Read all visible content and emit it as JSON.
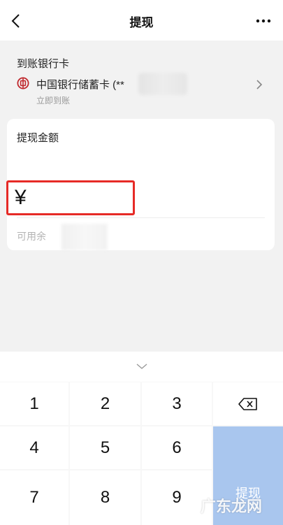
{
  "header": {
    "title": "提现",
    "back_icon": "chevron-left-icon",
    "more_icon": "more-dots-icon"
  },
  "bank": {
    "label": "到账银行卡",
    "name": "中国银行储蓄卡 (**",
    "subtitle": "立即到账",
    "icon": "bank-of-china-icon"
  },
  "amount": {
    "label": "提现金额",
    "currency": "¥",
    "balance_prefix": "可用余"
  },
  "keypad": {
    "keys": [
      "1",
      "2",
      "3",
      "4",
      "5",
      "6",
      "7",
      "8",
      "9"
    ],
    "submit_label": "提现",
    "delete_icon": "backspace-icon",
    "collapse_icon": "chevron-down-icon"
  },
  "watermark": "广东龙网",
  "colors": {
    "highlight": "#e62a26",
    "submit": "#a9c6ee",
    "bank_icon": "#c0282d"
  }
}
